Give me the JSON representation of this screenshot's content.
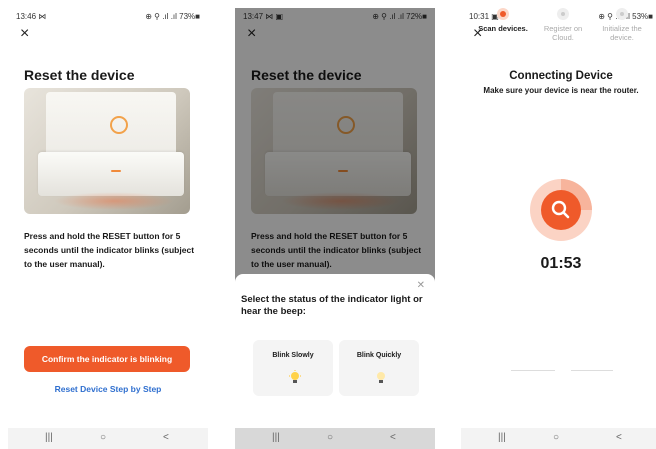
{
  "colors": {
    "accent": "#ef5a2a",
    "link": "#2f6fcf"
  },
  "screen1": {
    "status": {
      "time": "13:46 ⋈",
      "indicators": "⊕ ⚲ .ıl .ıl 73%■"
    },
    "title": "Reset the device",
    "description": "Press and hold the RESET button for 5 seconds until the indicator blinks (subject to the user manual).",
    "primary_button": "Confirm the indicator is blinking",
    "link": "Reset Device Step by Step"
  },
  "screen2": {
    "status": {
      "time": "13:47 ⋈ ▣",
      "indicators": "⊕ ⚲ .ıl .ıl 72%■"
    },
    "title": "Reset the device",
    "description": "Press and hold the RESET button for 5 seconds until the indicator blinks (subject to the user manual).",
    "sheet_title": "Select the status of the indicator light or hear the beep:",
    "options": [
      {
        "label": "Blink Slowly",
        "icon": "bulb-lit-icon"
      },
      {
        "label": "Blink Quickly",
        "icon": "bulb-icon"
      }
    ]
  },
  "screen3": {
    "status": {
      "time": "10:31 ▣",
      "indicators": "⊕ ⚲ .ıl .ıl 53%■"
    },
    "title": "Connecting Device",
    "subtitle": "Make sure your device is near the router.",
    "timer": "01:53",
    "steps": [
      {
        "label": "Scan devices.",
        "state": "active"
      },
      {
        "label": "Register on Cloud.",
        "state": "inactive"
      },
      {
        "label": "Initialize the device.",
        "state": "inactive"
      }
    ]
  },
  "navbar": {
    "recent": "|||",
    "home": "○",
    "back": "<"
  }
}
